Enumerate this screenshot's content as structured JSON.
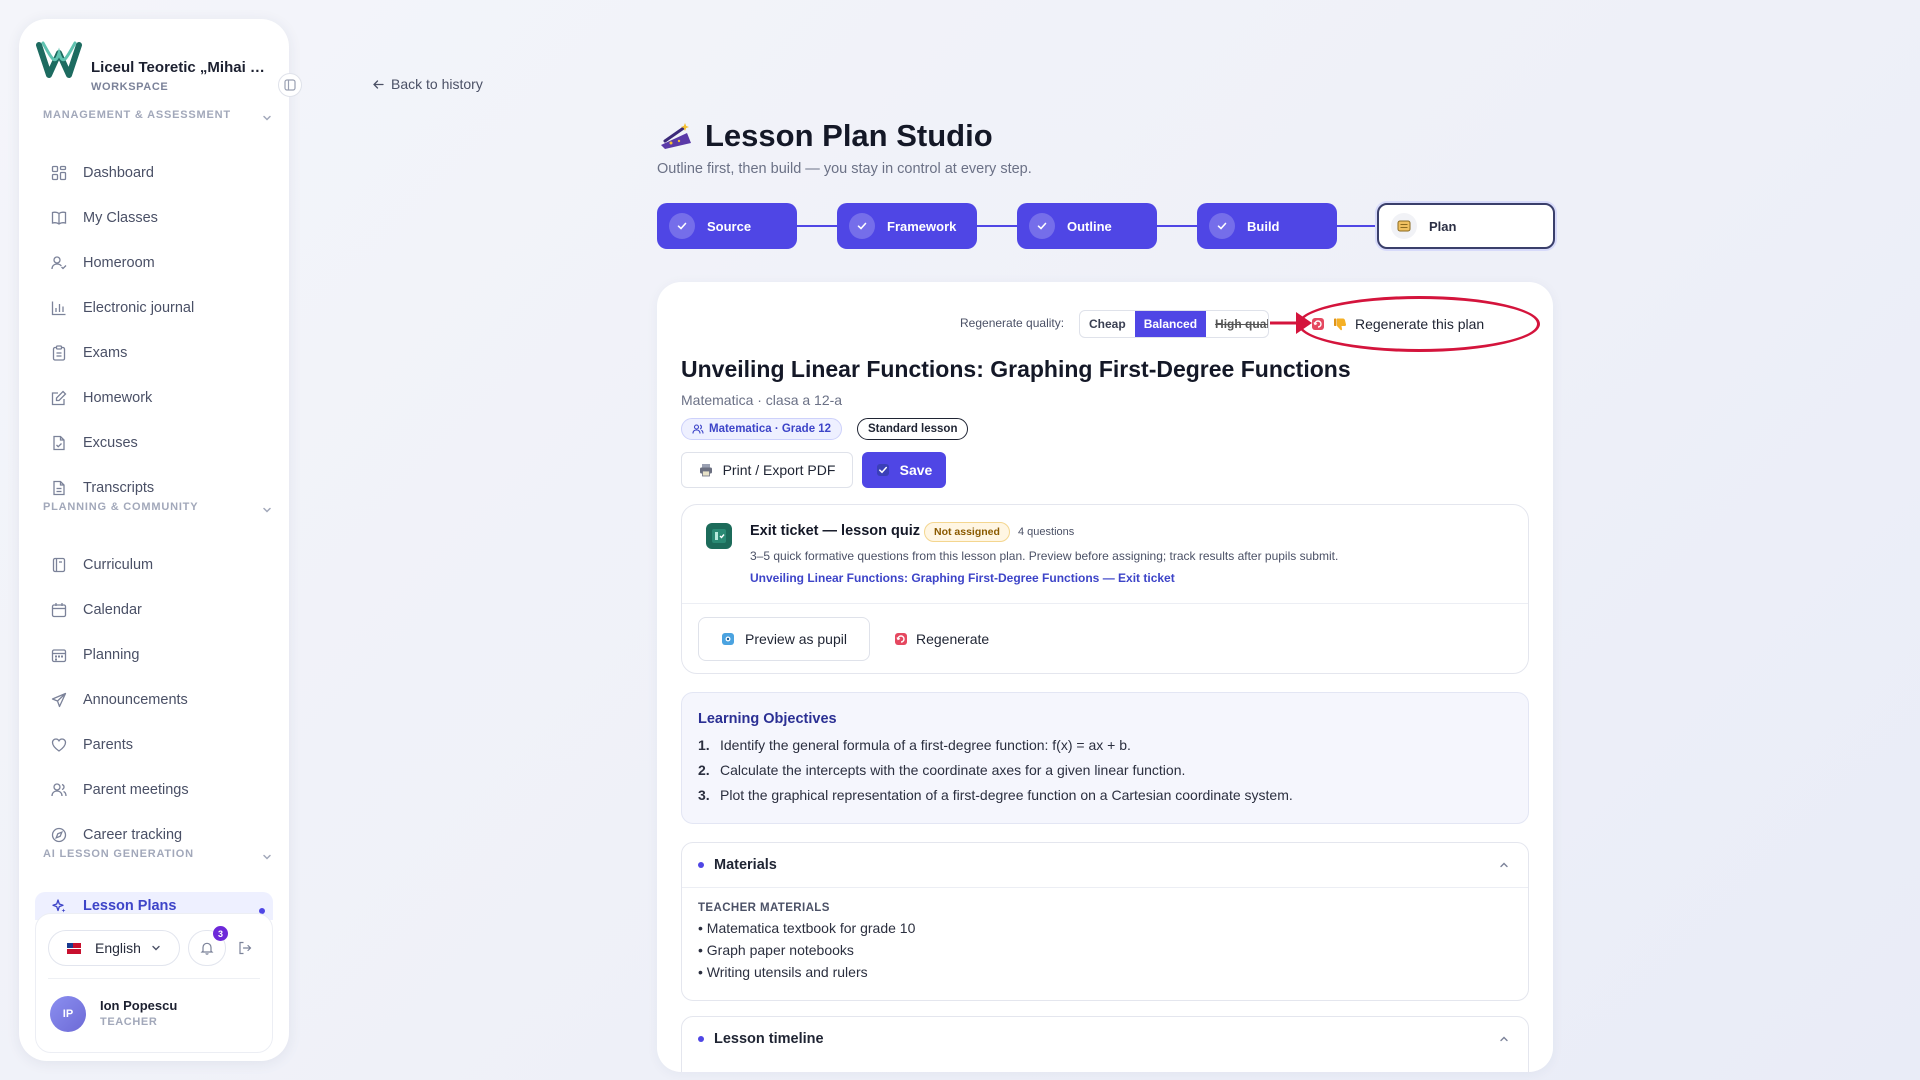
{
  "workspace": {
    "name": "Liceul Teoretic „Mihai Eminescu”",
    "label": "WORKSPACE"
  },
  "sections": [
    {
      "title": "MANAGEMENT & ASSESSMENT"
    },
    {
      "title": "PLANNING & COMMUNITY"
    },
    {
      "title": "AI LESSON GENERATION"
    }
  ],
  "nav": {
    "management": [
      {
        "label": "Dashboard",
        "icon": "grid-icon"
      },
      {
        "label": "My Classes",
        "icon": "book-icon"
      },
      {
        "label": "Homeroom",
        "icon": "user-check-icon"
      },
      {
        "label": "Electronic journal",
        "icon": "bar-chart-icon"
      },
      {
        "label": "Exams",
        "icon": "clipboard-icon"
      },
      {
        "label": "Homework",
        "icon": "edit-icon"
      },
      {
        "label": "Excuses",
        "icon": "file-check-icon"
      },
      {
        "label": "Transcripts",
        "icon": "file-text-icon"
      }
    ],
    "planning": [
      {
        "label": "Curriculum",
        "icon": "notebook-icon"
      },
      {
        "label": "Calendar",
        "icon": "calendar-icon"
      },
      {
        "label": "Planning",
        "icon": "calendar-grid-icon"
      },
      {
        "label": "Announcements",
        "icon": "send-icon"
      },
      {
        "label": "Parents",
        "icon": "heart-icon"
      },
      {
        "label": "Parent meetings",
        "icon": "users-icon"
      },
      {
        "label": "Career tracking",
        "icon": "compass-icon"
      }
    ],
    "ai": [
      {
        "label": "Lesson Plans",
        "icon": "sparkles-icon"
      }
    ]
  },
  "footer": {
    "language": "English",
    "notifications": "3",
    "user": {
      "initials": "IP",
      "name": "Ion Popescu",
      "role": "TEACHER"
    }
  },
  "back_link": "Back to history",
  "studio": {
    "title": "Lesson Plan Studio",
    "subtitle": "Outline first, then build — you stay in control at every step.",
    "steps": [
      "Source",
      "Framework",
      "Outline",
      "Build",
      "Plan"
    ]
  },
  "quality": {
    "label": "Regenerate quality:",
    "options": [
      "Cheap",
      "Balanced",
      "High quality"
    ],
    "selected": "Balanced",
    "regenerate_plan": "Regenerate this plan"
  },
  "plan": {
    "title": "Unveiling Linear Functions: Graphing First-Degree Functions",
    "meta": "Matematica · clasa a 12-a",
    "subject_tag": "Matematica · Grade 12",
    "type_tag": "Standard lesson",
    "print_label": "Print / Export PDF",
    "save_label": "Save"
  },
  "quiz": {
    "title": "Exit ticket — lesson quiz",
    "status": "Not assigned",
    "count": "4 questions",
    "description": "3–5 quick formative questions from this lesson plan. Preview before assigning; track results after pupils submit.",
    "link": "Unveiling Linear Functions: Graphing First-Degree Functions — Exit ticket",
    "preview_label": "Preview as pupil",
    "regenerate_label": "Regenerate"
  },
  "objectives": {
    "title": "Learning Objectives",
    "items": [
      {
        "num": "1.",
        "text": "Identify the general formula of a first-degree function: f(x) = ax + b."
      },
      {
        "num": "2.",
        "text": "Calculate the intercepts with the coordinate axes for a given linear function."
      },
      {
        "num": "3.",
        "text": "Plot the graphical representation of a first-degree function on a Cartesian coordinate system."
      }
    ]
  },
  "materials": {
    "title": "Materials",
    "subtitle": "TEACHER MATERIALS",
    "items": [
      "• Matematica textbook for grade 10",
      "• Graph paper notebooks",
      "• Writing utensils and rulers"
    ]
  },
  "timeline": {
    "title": "Lesson timeline"
  },
  "colors": {
    "accent": "#4f46e5",
    "highlight": "#d4143c"
  }
}
